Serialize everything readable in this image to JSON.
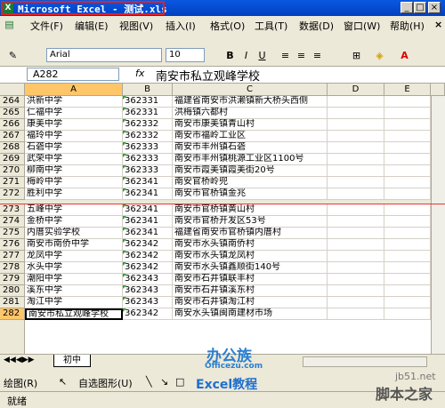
{
  "window": {
    "title": "Microsoft Excel - 测试.xls",
    "icon_letter": "X",
    "controls": [
      "_",
      "□",
      "×"
    ]
  },
  "menu": {
    "items": [
      "文件(F)",
      "编辑(E)",
      "视图(V)",
      "插入(I)",
      "格式(O)",
      "工具(T)",
      "数据(D)",
      "窗口(W)",
      "帮助(H)"
    ],
    "close_glyph": "×"
  },
  "toolbar": {
    "font": "Arial",
    "size": "10",
    "bold": "B",
    "italic": "I",
    "underline": "U",
    "font_color_letter": "A"
  },
  "formula_bar": {
    "name_box": "A282",
    "fx": "fx",
    "content": "南安市私立观峰学校"
  },
  "columns": [
    "A",
    "B",
    "C",
    "D",
    "E"
  ],
  "rows": [
    {
      "num": "264",
      "a": "洪新中学",
      "b": "362331",
      "c": "福建省南安市洪濑镇新大桥头西侧"
    },
    {
      "num": "265",
      "a": "仁福中学",
      "b": "362331",
      "c": "洪梅镇六都村"
    },
    {
      "num": "266",
      "a": "康美中学",
      "b": "362332",
      "c": "南安市康美镇青山村"
    },
    {
      "num": "267",
      "a": "福玲中学",
      "b": "362332",
      "c": "南安市福岭工业区"
    },
    {
      "num": "268",
      "a": "石砻中学",
      "b": "362333",
      "c": "南安市丰州镇石砻"
    },
    {
      "num": "269",
      "a": "武荣中学",
      "b": "362333",
      "c": "南安市丰州镇桃源工业区1100号"
    },
    {
      "num": "270",
      "a": "柳南中学",
      "b": "362333",
      "c": "南安市霞美镇霞美街20号"
    },
    {
      "num": "271",
      "a": "梅岭中学",
      "b": "362341",
      "c": "南安官桥岭兜"
    },
    {
      "num": "272",
      "a": "胜利中学",
      "b": "362341",
      "c": "南安市官桥镇金兆"
    },
    {
      "num": "273",
      "a": "五峰中学",
      "b": "362341",
      "c": "南安市官桥镇黄山村"
    },
    {
      "num": "274",
      "a": "金桥中学",
      "b": "362341",
      "c": "南安市官桥开发区53号"
    },
    {
      "num": "275",
      "a": "内厝实验学校",
      "b": "362341",
      "c": "福建省南安市官桥镇内厝村"
    },
    {
      "num": "276",
      "a": "南安市南侨中学",
      "b": "362342",
      "c": "南安市水头镇南侨村"
    },
    {
      "num": "277",
      "a": "龙凤中学",
      "b": "362342",
      "c": "南安市水头镇龙凤村"
    },
    {
      "num": "278",
      "a": "水头中学",
      "b": "362342",
      "c": "南安市水头镇鑫顺街140号"
    },
    {
      "num": "279",
      "a": "潮阳中学",
      "b": "362343",
      "c": "南安市石井镇联丰村"
    },
    {
      "num": "280",
      "a": "溪东中学",
      "b": "362343",
      "c": "南安市石井镇溪东村"
    },
    {
      "num": "281",
      "a": "淘江中学",
      "b": "362343",
      "c": "南安市石井镇淘江村"
    },
    {
      "num": "282",
      "a": "南安市私立观峰学校",
      "b": "362342",
      "c": "南安水头镇闽南建材市场"
    }
  ],
  "sheet_tab": "初中",
  "draw_toolbar": {
    "draw": "绘图(R)",
    "autoshapes": "自选图形(U)"
  },
  "status": "就绪",
  "watermarks": {
    "office_logo": "办公族",
    "office_site": "Officezu.com",
    "excel_tutorial": "Excel教程",
    "jb51": "jb51.net",
    "jiaoben": "脚本之家"
  },
  "colors": {
    "selection_border": "#000000",
    "red_highlight": "#e0202a",
    "title_blue": "#0a58e0"
  }
}
